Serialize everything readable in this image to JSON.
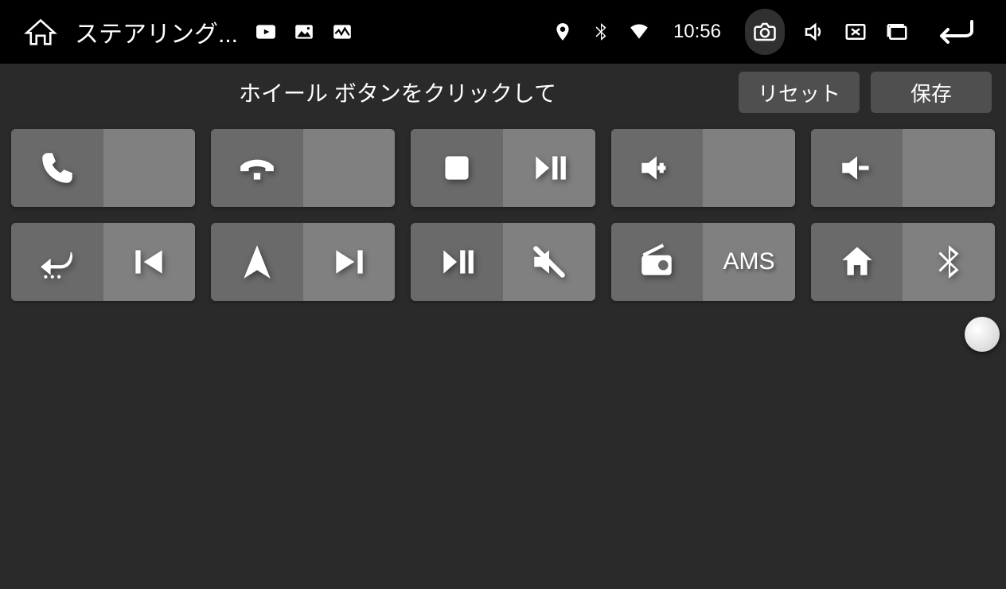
{
  "statusbar": {
    "app_title": "ステアリング...",
    "clock": "10:56"
  },
  "subheader": {
    "title": "ホイール ボタンをクリックして",
    "reset_label": "リセット",
    "save_label": "保存"
  },
  "grid": {
    "cells": [
      {
        "left_icon": "phone",
        "right_icon": ""
      },
      {
        "left_icon": "phone-end",
        "right_icon": ""
      },
      {
        "left_icon": "stop",
        "right_icon": "play-pause"
      },
      {
        "left_icon": "vol-up",
        "right_icon": ""
      },
      {
        "left_icon": "vol-down",
        "right_icon": ""
      },
      {
        "left_icon": "back-curve",
        "right_icon": "prev-track"
      },
      {
        "left_icon": "navigate",
        "right_icon": "next-track"
      },
      {
        "left_icon": "play-pause",
        "right_icon": "mute"
      },
      {
        "left_icon": "radio",
        "right_text": "AMS"
      },
      {
        "left_icon": "home",
        "right_icon": "bluetooth"
      }
    ]
  }
}
